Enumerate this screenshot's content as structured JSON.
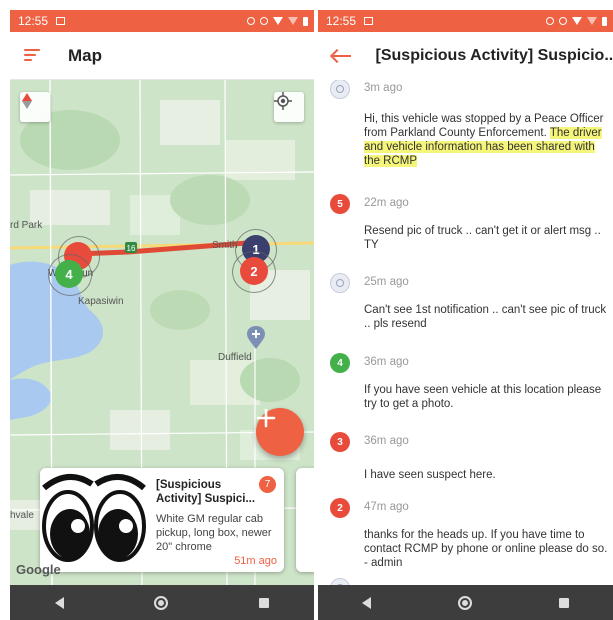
{
  "left": {
    "status": {
      "time": "12:55"
    },
    "appbar": {
      "title": "Map"
    },
    "map": {
      "labels": {
        "park": "rd Park",
        "wabamun": "Wabamun",
        "kapasiwin": "Kapasiwin",
        "smith": "Smith",
        "duffield": "Duffield",
        "hvale": "hvale"
      },
      "pins": [
        {
          "label": "1",
          "color": "#3b3f6e"
        },
        {
          "label": "2",
          "color": "#e84b3c"
        },
        {
          "label": "4",
          "color": "#43b04a"
        },
        {
          "label": "",
          "color": "#e84b3c"
        }
      ],
      "route_color": "#e04a35",
      "attribution": "Google"
    },
    "card": {
      "title": "[Suspicious Activity] Suspici...",
      "count": "7",
      "description": "White GM regular cab pickup, long box, newer 20\" chrome",
      "time": "51m ago"
    }
  },
  "right": {
    "status": {
      "time": "12:55"
    },
    "appbar": {
      "title": "[Suspicious Activity] Suspicio..."
    },
    "messages": [
      {
        "avatar": "",
        "avatar_color": "",
        "time": "3m ago",
        "text": "Hi, this vehicle was stopped by a Peace Officer from Parkland County Enforcement.",
        "highlight": "The driver and vehicle information has been shared with the RCMP"
      },
      {
        "avatar": "5",
        "avatar_color": "#e84b3c",
        "time": "22m ago",
        "text": "Resend pic of truck .. can't get it or alert msg .. TY",
        "highlight": ""
      },
      {
        "avatar": "",
        "avatar_color": "",
        "time": "25m ago",
        "text": "Can't see 1st notification .. can't see pic of truck .. pls resend",
        "highlight": ""
      },
      {
        "avatar": "4",
        "avatar_color": "#43b04a",
        "time": "36m ago",
        "text": "If you have seen vehicle at this location please try to get a photo.",
        "highlight": ""
      },
      {
        "avatar": "3",
        "avatar_color": "#e84b3c",
        "time": "36m ago",
        "text": "I have seen suspect here.",
        "highlight": ""
      },
      {
        "avatar": "2",
        "avatar_color": "#e84b3c",
        "time": "47m ago",
        "text": "thanks for the heads up.  If you have time to contact RCMP by phone or online please do so. - admin",
        "highlight": ""
      }
    ]
  },
  "colors": {
    "accent": "#ee6143",
    "navbar": "#3d3d3d",
    "highlight": "#f5f57a"
  }
}
